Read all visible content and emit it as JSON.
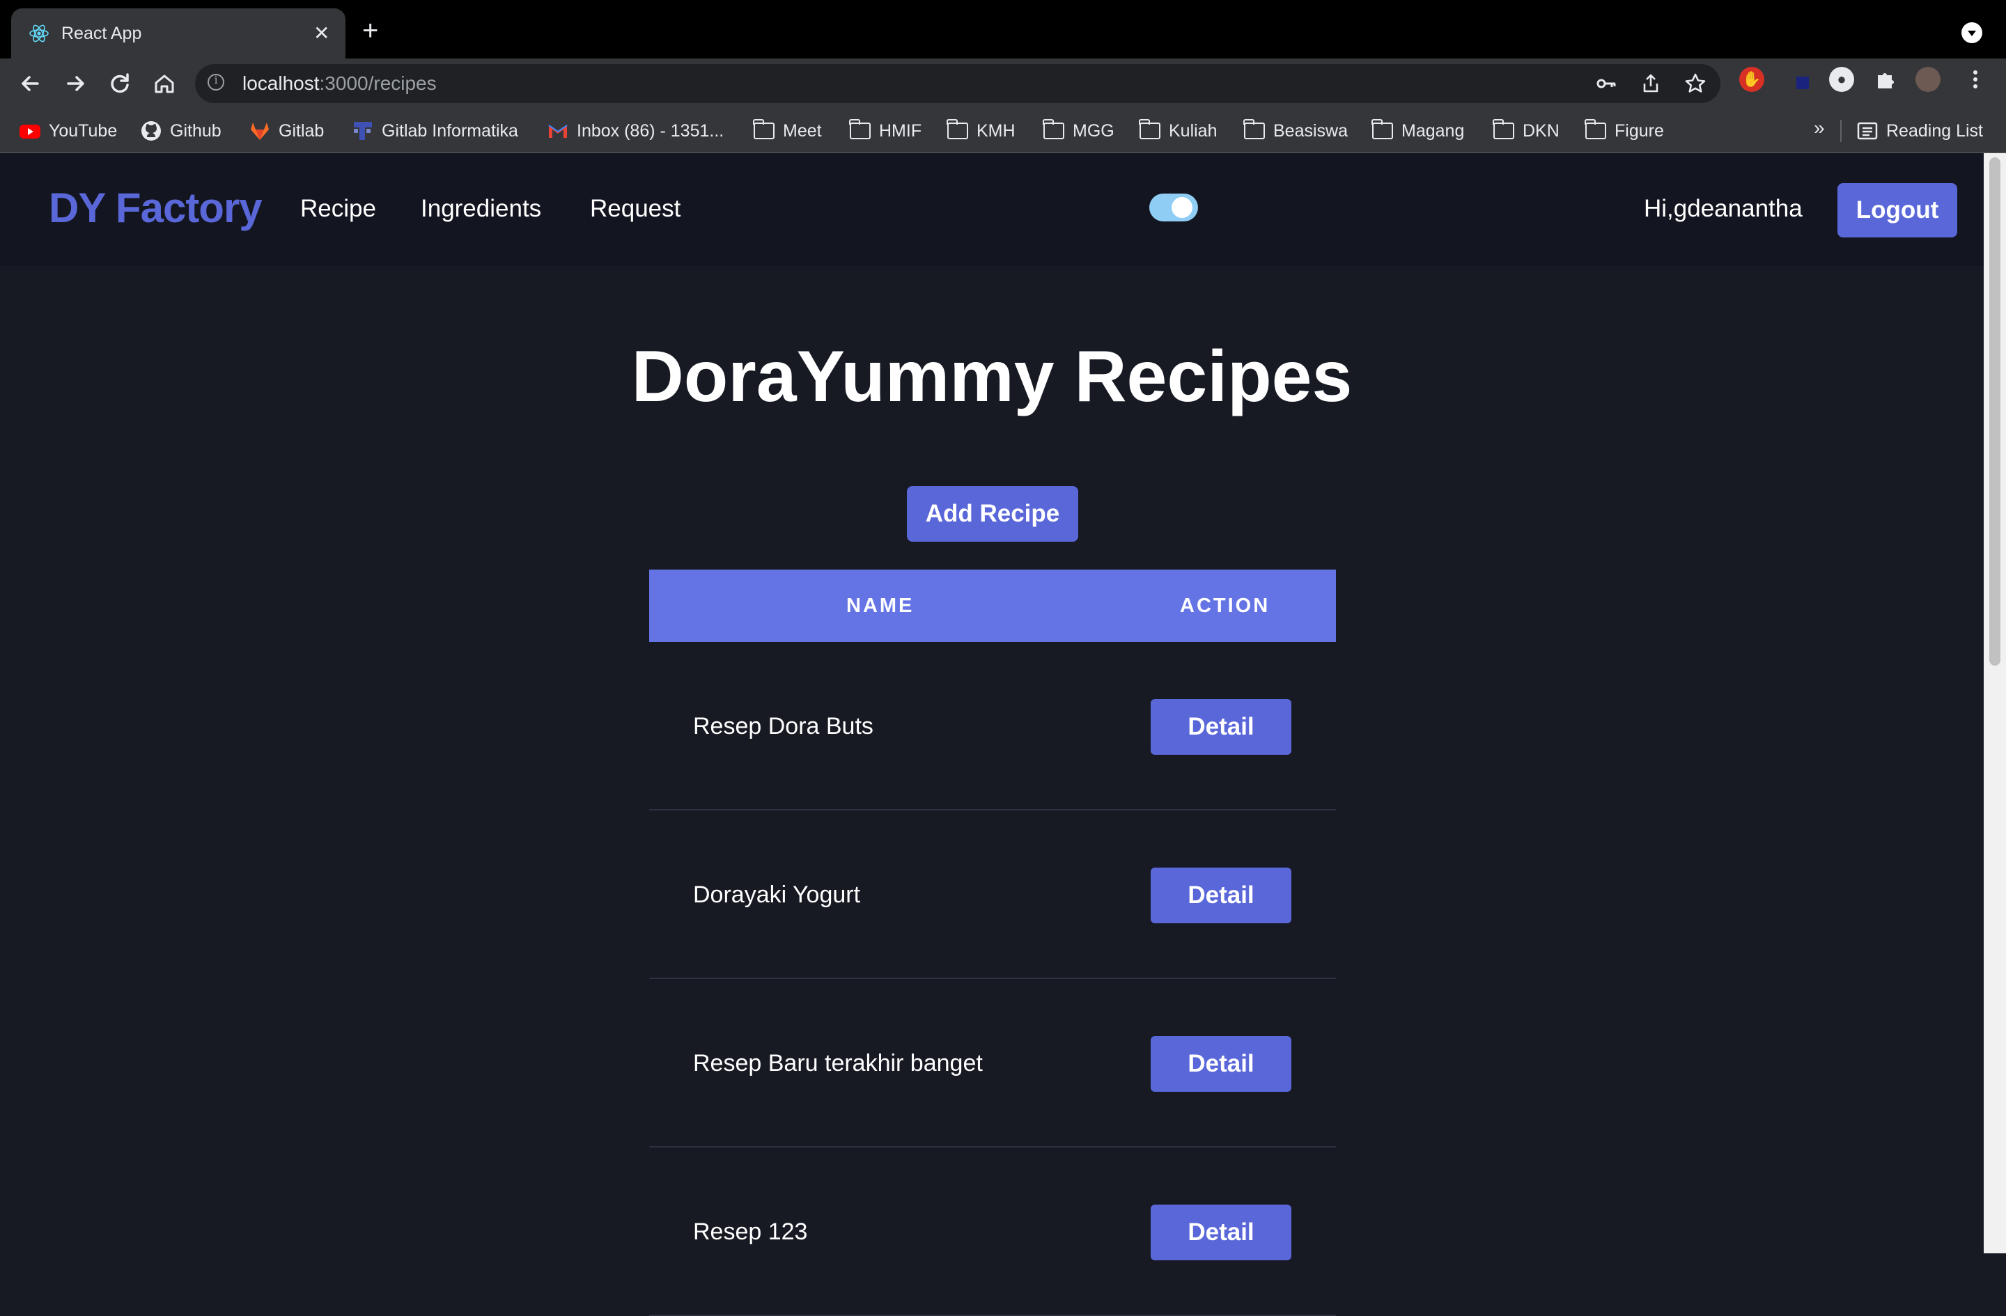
{
  "browser": {
    "tab_title": "React App",
    "tab_close": "✕",
    "new_tab": "+",
    "url_host": "localhost",
    "url_path": ":3000/recipes",
    "bookmarks": [
      {
        "label": "YouTube",
        "icon": "youtube-icon"
      },
      {
        "label": "Github",
        "icon": "github-icon"
      },
      {
        "label": "Gitlab",
        "icon": "gitlab-icon"
      },
      {
        "label": "Gitlab Informatika",
        "icon": "gitlab-informatika-icon"
      },
      {
        "label": "Inbox (86) - 1351...",
        "icon": "gmail-icon"
      },
      {
        "label": "Meet",
        "icon": "folder-icon"
      },
      {
        "label": "HMIF",
        "icon": "folder-icon"
      },
      {
        "label": "KMH",
        "icon": "folder-icon"
      },
      {
        "label": "MGG",
        "icon": "folder-icon"
      },
      {
        "label": "Kuliah",
        "icon": "folder-icon"
      },
      {
        "label": "Beasiswa",
        "icon": "folder-icon"
      },
      {
        "label": "Magang",
        "icon": "folder-icon"
      },
      {
        "label": "DKN",
        "icon": "folder-icon"
      },
      {
        "label": "Figure",
        "icon": "folder-icon"
      }
    ],
    "bookmarks_overflow": "»",
    "reading_list": "Reading List"
  },
  "nav": {
    "brand": "DY Factory",
    "links": [
      "Recipe",
      "Ingredients",
      "Request"
    ],
    "greeting": "Hi,gdeanantha",
    "logout": "Logout",
    "theme_toggle_on": true
  },
  "main": {
    "title": "DoraYummy Recipes",
    "add_button": "Add Recipe",
    "table": {
      "headers": [
        "NAME",
        "ACTION"
      ],
      "rows": [
        {
          "name": "Resep Dora Buts",
          "action": "Detail"
        },
        {
          "name": "Dorayaki Yogurt",
          "action": "Detail"
        },
        {
          "name": "Resep Baru terakhir banget",
          "action": "Detail"
        },
        {
          "name": "Resep 123",
          "action": "Detail"
        }
      ]
    }
  },
  "colors": {
    "accent": "#5a67d8",
    "table_header": "#6474e5",
    "background": "#171923",
    "navbar": "#131620",
    "toggle": "#90cdf4"
  }
}
